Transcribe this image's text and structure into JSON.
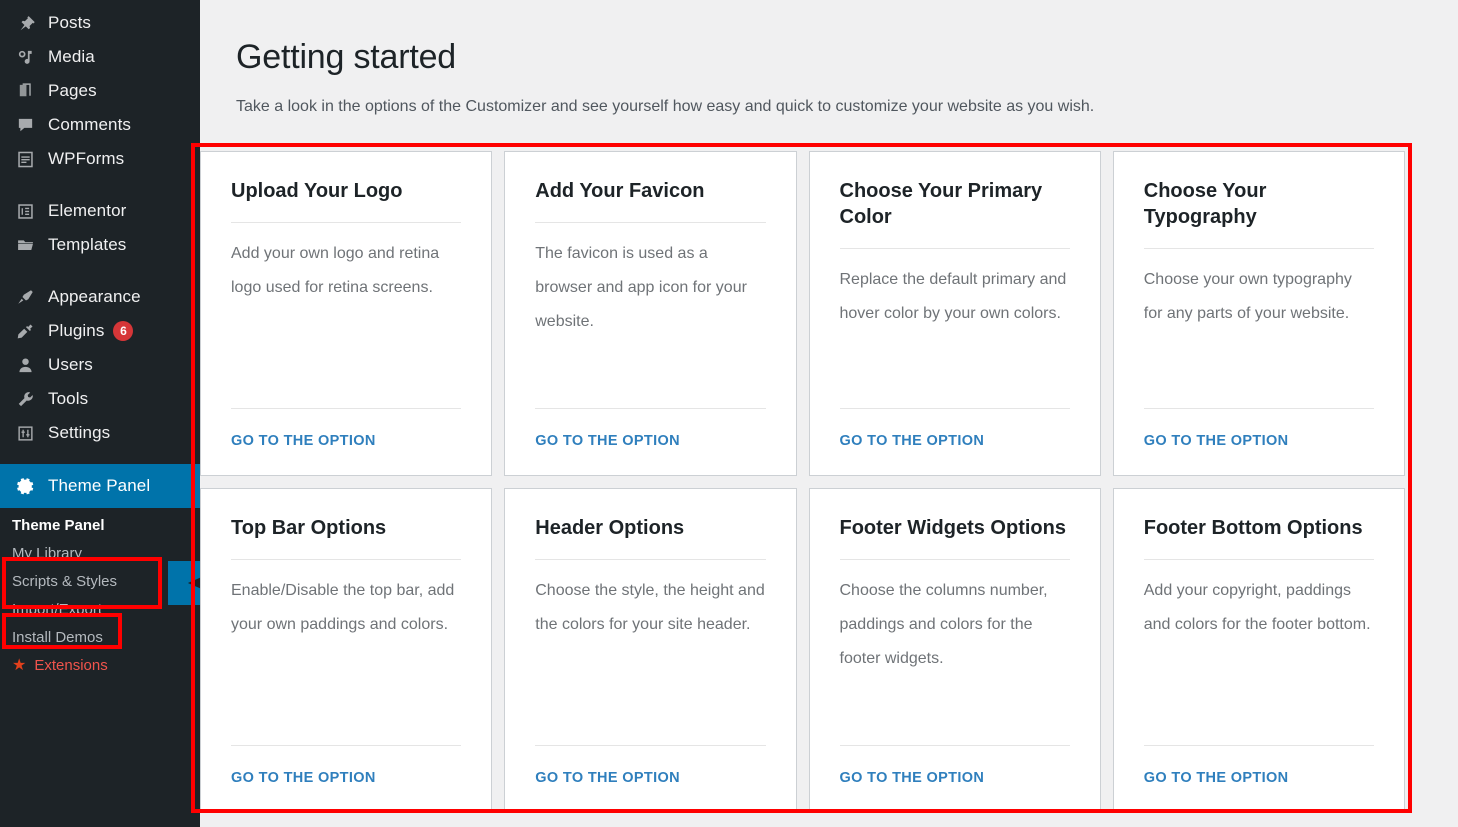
{
  "sidebar": {
    "items": [
      {
        "label": "Posts",
        "icon": "pin-icon"
      },
      {
        "label": "Media",
        "icon": "media-icon"
      },
      {
        "label": "Pages",
        "icon": "pages-icon"
      },
      {
        "label": "Comments",
        "icon": "comment-icon"
      },
      {
        "label": "WPForms",
        "icon": "form-icon"
      },
      {
        "label": "Elementor",
        "icon": "elementor-icon"
      },
      {
        "label": "Templates",
        "icon": "folder-icon"
      },
      {
        "label": "Appearance",
        "icon": "brush-icon"
      },
      {
        "label": "Plugins",
        "icon": "plug-icon",
        "badge": "6"
      },
      {
        "label": "Users",
        "icon": "user-icon"
      },
      {
        "label": "Tools",
        "icon": "wrench-icon"
      },
      {
        "label": "Settings",
        "icon": "sliders-icon"
      }
    ],
    "current": {
      "label": "Theme Panel",
      "icon": "gear-icon"
    },
    "submenu": [
      {
        "label": "Theme Panel"
      },
      {
        "label": "My Library"
      },
      {
        "label": "Scripts & Styles"
      },
      {
        "label": "Import/Export"
      },
      {
        "label": "Install Demos"
      },
      {
        "label": "Extensions",
        "icon": "star-icon"
      }
    ],
    "colors": {
      "background": "#1d2327",
      "current_bg": "#0073aa",
      "badge": "#d63638",
      "extensions": "#f0544c"
    }
  },
  "page": {
    "title": "Getting started",
    "subtitle": "Take a look in the options of the Customizer and see yourself how easy and quick to customize your website as you wish."
  },
  "cards": [
    {
      "title": "Upload Your Logo",
      "description": "Add your own logo and retina logo used for retina screens.",
      "link": "GO TO THE OPTION"
    },
    {
      "title": "Add Your Favicon",
      "description": "The favicon is used as a browser and app icon for your website.",
      "link": "GO TO THE OPTION"
    },
    {
      "title": "Choose Your Primary Color",
      "description": "Replace the default primary and hover color by your own colors.",
      "link": "GO TO THE OPTION"
    },
    {
      "title": "Choose Your Typography",
      "description": "Choose your own typography for any parts of your website.",
      "link": "GO TO THE OPTION"
    },
    {
      "title": "Top Bar Options",
      "description": "Enable/Disable the top bar, add your own paddings and colors.",
      "link": "GO TO THE OPTION"
    },
    {
      "title": "Header Options",
      "description": "Choose the style, the height and the colors for your site header.",
      "link": "GO TO THE OPTION"
    },
    {
      "title": "Footer Widgets Options",
      "description": "Choose the columns number, paddings and colors for the footer widgets.",
      "link": "GO TO THE OPTION"
    },
    {
      "title": "Footer Bottom Options",
      "description": "Add your copyright, paddings and colors for the footer bottom.",
      "link": "GO TO THE OPTION"
    }
  ],
  "annotations": {
    "highlight_color": "#ff0000"
  }
}
